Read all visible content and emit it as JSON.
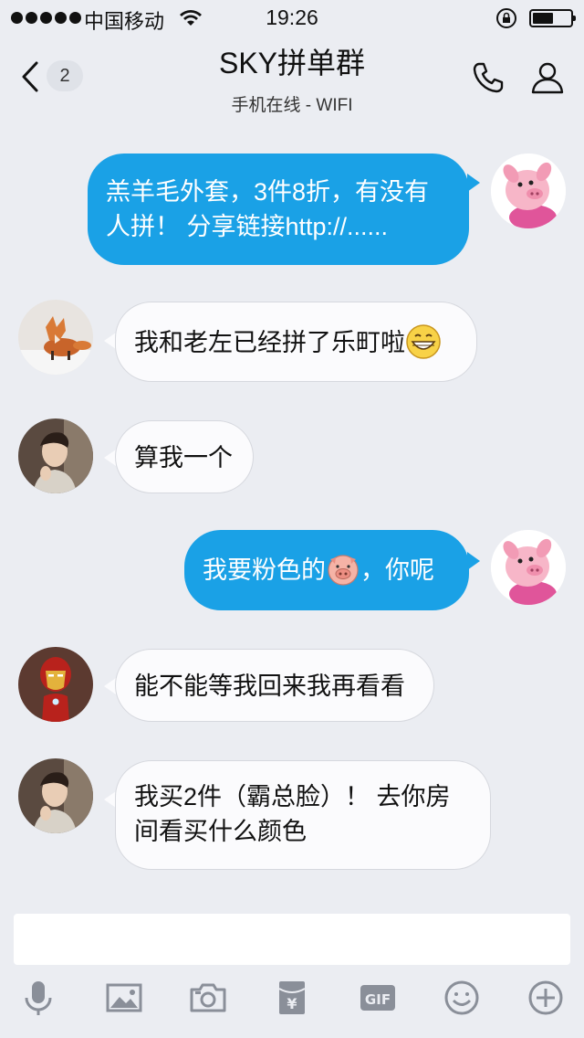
{
  "status_bar": {
    "carrier": "中国移动",
    "time": "19:26"
  },
  "header": {
    "unread_count": "2",
    "title": "SKY拼单群",
    "subtitle": "手机在线 - WIFI"
  },
  "messages": [
    {
      "side": "out",
      "line1": "羔羊毛外套，3件8折，有没有",
      "line2": "人拼！ 分享链接http://......"
    },
    {
      "side": "in",
      "text": "我和老左已经拼了乐町啦"
    },
    {
      "side": "in",
      "text": "算我一个"
    },
    {
      "side": "out",
      "text_before": "我要粉色的",
      "text_after": "，你呢"
    },
    {
      "side": "in",
      "text": "能不能等我回来我再看看"
    },
    {
      "side": "in",
      "line1": "我买2件（霸总脸）！ 去你房",
      "line2": "间看买什么颜色"
    }
  ],
  "input": {
    "value": "",
    "placeholder": ""
  },
  "toolbar_icons": [
    "microphone-icon",
    "image-icon",
    "camera-icon",
    "red-packet-icon",
    "gif-icon",
    "emoji-icon",
    "plus-icon"
  ],
  "colors": {
    "accent": "#1aa1e6",
    "background": "#ebedf2"
  }
}
